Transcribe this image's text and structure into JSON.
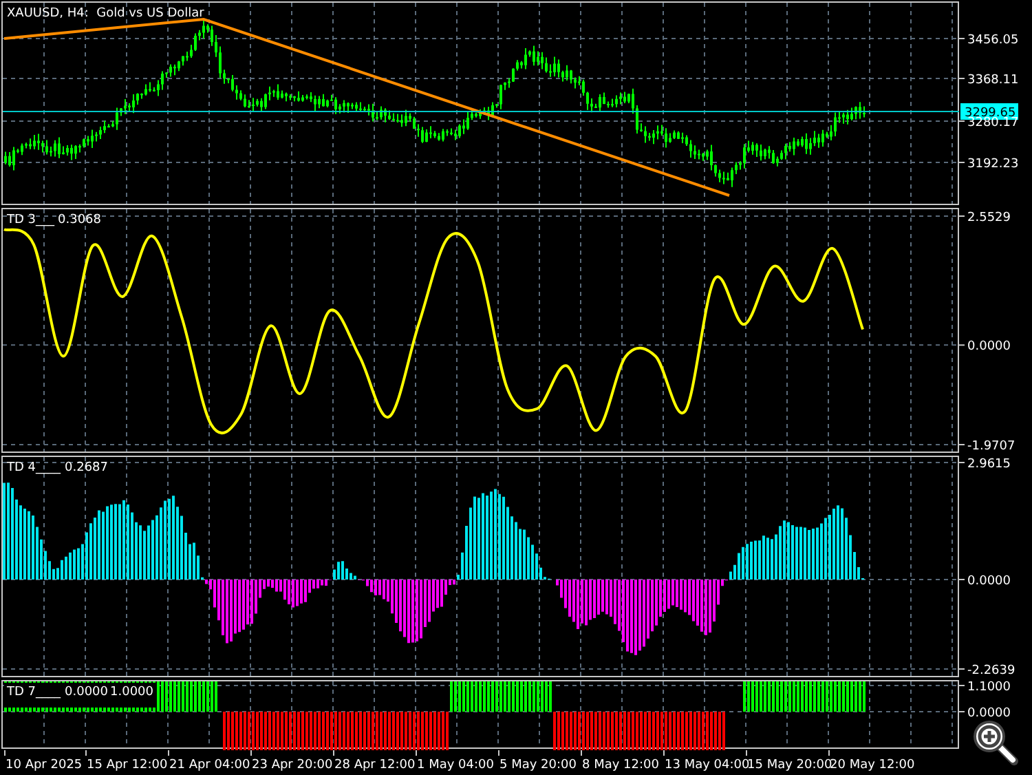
{
  "panes": [
    {
      "kind": "price",
      "title": "XAUUSD, H4:  Gold vs US Dollar",
      "ticks": [
        "3456.05",
        "3368.11",
        "3280.17",
        "3192.23"
      ],
      "current_price": "3299.65"
    },
    {
      "kind": "line",
      "label": "TD 3___",
      "values": [
        "0.3068"
      ],
      "chart_data": {
        "type": "line",
        "grid": true,
        "ylim": [
          -1.9707,
          2.5529
        ],
        "yticks": [
          {
            "value": 2.5529,
            "label": "2.5529"
          },
          {
            "value": 0,
            "label": "0.0000"
          },
          {
            "value": -1.9707,
            "label": "-1.9707"
          }
        ],
        "series": [
          {
            "color": "#ffff00",
            "values": [
              2.29,
              1.99,
              -0.22,
              1.97,
              0.96,
              2.16,
              0.55,
              -1.58,
              -1.37,
              0.38,
              -0.96,
              0.68,
              -0.22,
              -1.42,
              0.41,
              2.13,
              1.64,
              -0.87,
              -1.26,
              -0.41,
              -1.69,
              -0.22,
              -0.22,
              -1.31,
              1.31,
              0.41,
              1.56,
              0.87,
              1.91,
              0.31
            ]
          }
        ]
      }
    },
    {
      "kind": "histogram",
      "label": "TD 4____",
      "values": [
        "0.2687"
      ],
      "ticks": [
        "2.9615",
        "0.0000",
        "-2.2639"
      ]
    },
    {
      "kind": "signal",
      "label": "TD 7____",
      "values": [
        "0.0000",
        "1.0000"
      ],
      "ticks": [
        "1.1000",
        "0.0000"
      ]
    }
  ],
  "time_labels": [
    "10 Apr 2025",
    "15 Apr 12:00",
    "21 Apr 04:00",
    "23 Apr 20:00",
    "28 Apr 12:00",
    "1 May 04:00",
    "5 May 20:00",
    "8 May 12:00",
    "13 May 04:00",
    "15 May 20:00",
    "20 May 12:00"
  ]
}
